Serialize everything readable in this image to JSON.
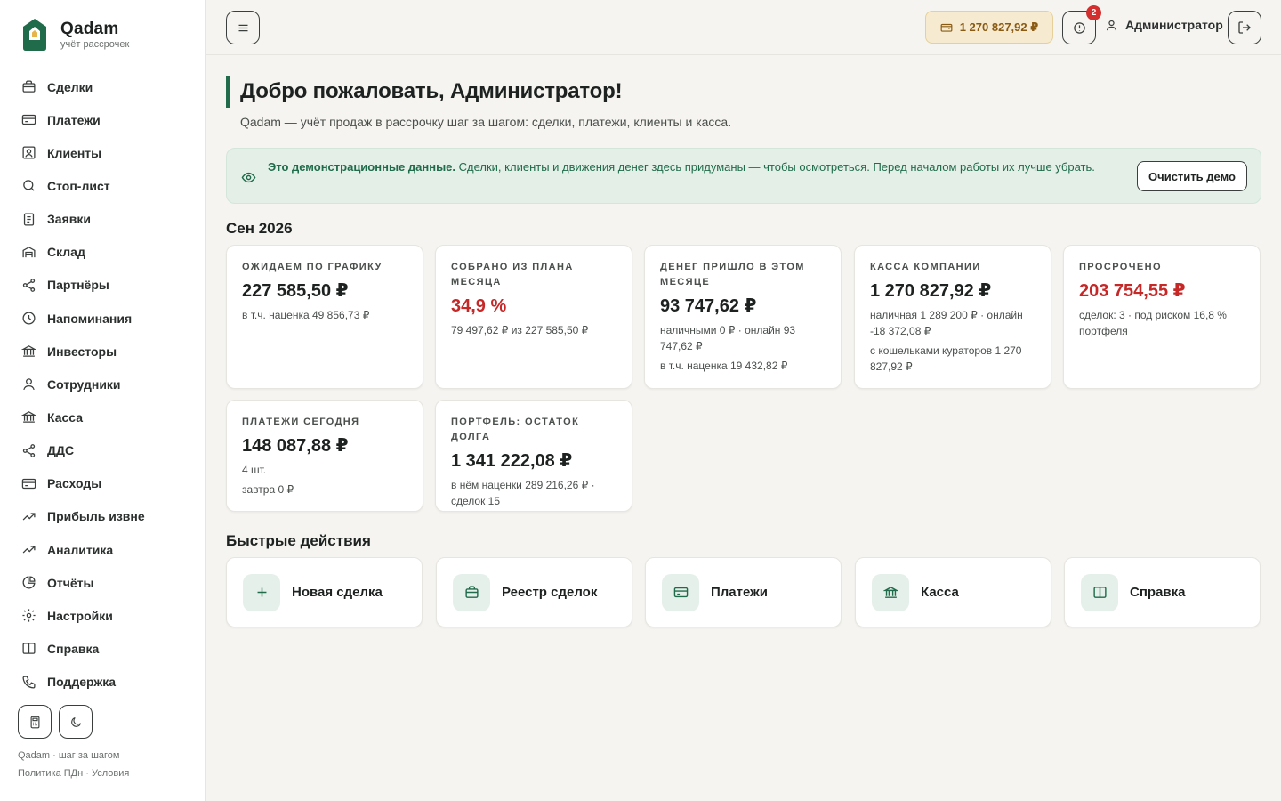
{
  "brand": {
    "name": "Qadam",
    "subtitle": "учёт рассрочек"
  },
  "sidebar": {
    "items": [
      {
        "label": "Сделки",
        "icon": "briefcase-icon"
      },
      {
        "label": "Платежи",
        "icon": "credit-card-icon"
      },
      {
        "label": "Клиенты",
        "icon": "contact-icon"
      },
      {
        "label": "Стоп-лист",
        "icon": "search-icon"
      },
      {
        "label": "Заявки",
        "icon": "document-icon"
      },
      {
        "label": "Склад",
        "icon": "warehouse-icon"
      },
      {
        "label": "Партнёры",
        "icon": "share-icon"
      },
      {
        "label": "Напоминания",
        "icon": "clock-icon"
      },
      {
        "label": "Инвесторы",
        "icon": "bank-icon"
      },
      {
        "label": "Сотрудники",
        "icon": "user-icon"
      },
      {
        "label": "Касса",
        "icon": "bank-icon"
      },
      {
        "label": "ДДС",
        "icon": "share-icon"
      },
      {
        "label": "Расходы",
        "icon": "credit-card-icon"
      },
      {
        "label": "Прибыль извне",
        "icon": "trend-up-icon"
      },
      {
        "label": "Аналитика",
        "icon": "trend-up-icon"
      },
      {
        "label": "Отчёты",
        "icon": "pie-chart-icon"
      },
      {
        "label": "Настройки",
        "icon": "gear-icon"
      },
      {
        "label": "Справка",
        "icon": "book-icon"
      },
      {
        "label": "Поддержка",
        "icon": "phone-icon"
      }
    ],
    "footer": {
      "line1": "Qadam · шаг за шагом",
      "line2": "Политика ПДн · Условия"
    }
  },
  "topbar": {
    "balance": "1 270 827,92 ₽",
    "alerts_count": "2",
    "user_name": "Администратор"
  },
  "hero": {
    "title": "Добро пожаловать, Администратор!",
    "subtitle": "Qadam — учёт продаж в рассрочку шаг за шагом: сделки, платежи, клиенты и касса."
  },
  "demo_banner": {
    "bold": "Это демонстрационные данные.",
    "text": " Сделки, клиенты и движения денег здесь придуманы — чтобы осмотреться. Перед началом работы их лучше убрать.",
    "button": "Очистить демо"
  },
  "period": "Сен 2026",
  "cards": {
    "expected": {
      "label": "Ожидаем по графику",
      "value": "227 585,50 ₽",
      "note1": "в т.ч. наценка 49 856,73 ₽"
    },
    "collected": {
      "label": "Собрано из плана месяца",
      "value": "34,9 %",
      "note1": "79 497,62 ₽ из 227 585,50 ₽"
    },
    "inflow": {
      "label": "Денег пришло в этом месяце",
      "value": "93 747,62 ₽",
      "note1": "наличными 0 ₽ · онлайн 93 747,62 ₽",
      "note2": "в т.ч. наценка 19 432,82 ₽"
    },
    "cashbox": {
      "label": "Касса компании",
      "value": "1 270 827,92 ₽",
      "note1": "наличная 1 289 200 ₽ · онлайн -18 372,08 ₽",
      "note2": "с кошельками кураторов 1 270 827,92 ₽"
    },
    "overdue": {
      "label": "Просрочено",
      "value": "203 754,55 ₽",
      "note1": "сделок: 3 · под риском 16,8 % портфеля"
    },
    "today": {
      "label": "Платежи сегодня",
      "value": "148 087,88 ₽",
      "note1": "4 шт.",
      "note2": "завтра 0 ₽"
    },
    "portfolio": {
      "label": "Портфель: остаток долга",
      "value": "1 341 222,08 ₽",
      "note1": "в нём наценки 289 216,26 ₽ · сделок 15"
    }
  },
  "quick_actions": {
    "title": "Быстрые действия",
    "items": [
      {
        "label": "Новая сделка",
        "icon": "plus-icon"
      },
      {
        "label": "Реестр сделок",
        "icon": "briefcase-icon"
      },
      {
        "label": "Платежи",
        "icon": "credit-card-icon"
      },
      {
        "label": "Касса",
        "icon": "bank-icon"
      },
      {
        "label": "Справка",
        "icon": "book-icon"
      }
    ]
  },
  "colors": {
    "accent": "#1f6b4a",
    "danger": "#c62828",
    "balance_bg": "#f6ead0",
    "balance_text": "#8a5a12"
  }
}
